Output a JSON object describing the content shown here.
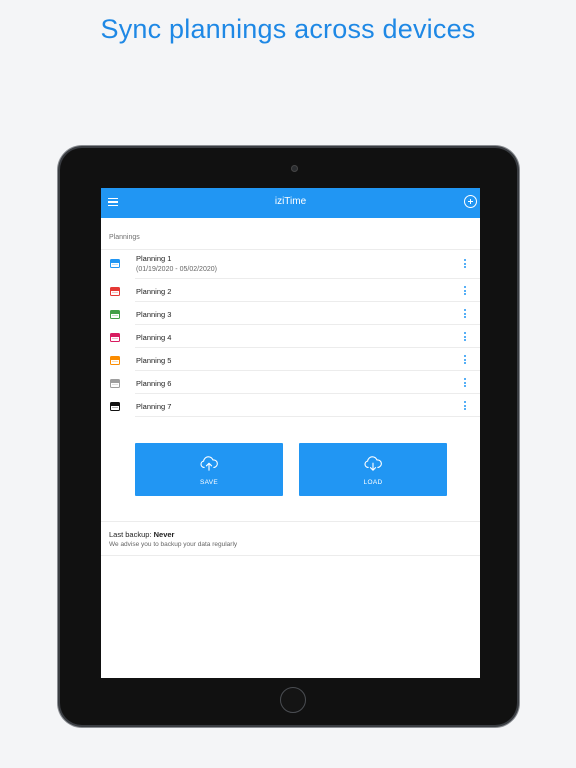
{
  "headline": "Sync plannings across devices",
  "colors": {
    "accent": "#2196f3",
    "headline": "#1e88e5"
  },
  "appbar": {
    "title": "iziTime",
    "menu_icon": "hamburger-menu-icon",
    "add_icon": "add-circle-icon"
  },
  "plannings": {
    "section_label": "Plannings",
    "items": [
      {
        "name": "Planning 1",
        "dates": "(01/19/2020 - 05/02/2020)",
        "color": "#2196f3"
      },
      {
        "name": "Planning 2",
        "color": "#e53935"
      },
      {
        "name": "Planning 3",
        "color": "#43a047"
      },
      {
        "name": "Planning 4",
        "color": "#d81b60"
      },
      {
        "name": "Planning 5",
        "color": "#fb8c00"
      },
      {
        "name": "Planning 6",
        "color": "#9e9e9e"
      },
      {
        "name": "Planning 7",
        "color": "#111111"
      }
    ]
  },
  "actions": {
    "save_label": "SAVE",
    "save_icon": "cloud-upload-icon",
    "load_label": "LOAD",
    "load_icon": "cloud-download-icon"
  },
  "backup": {
    "label": "Last backup:",
    "value": "Never",
    "advice": "We advise you to backup your data regularly"
  }
}
